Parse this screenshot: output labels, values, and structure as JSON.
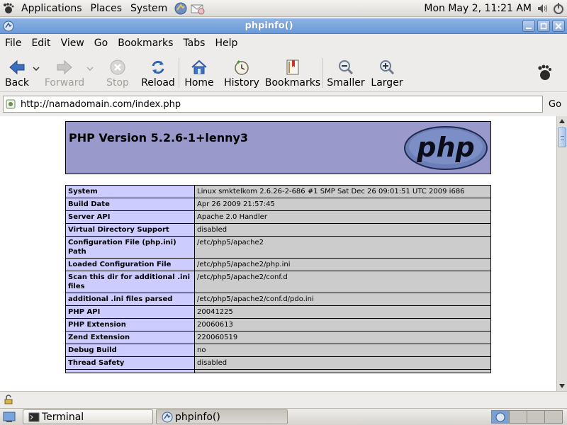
{
  "panel": {
    "menus": [
      "Applications",
      "Places",
      "System"
    ],
    "clock": "Mon May  2, 11:21 AM"
  },
  "window": {
    "title": "phpinfo()"
  },
  "menubar": [
    "File",
    "Edit",
    "View",
    "Go",
    "Bookmarks",
    "Tabs",
    "Help"
  ],
  "toolbar": {
    "back": "Back",
    "forward": "Forward",
    "stop": "Stop",
    "reload": "Reload",
    "home": "Home",
    "history": "History",
    "bookmarks": "Bookmarks",
    "smaller": "Smaller",
    "larger": "Larger"
  },
  "location": {
    "url": "http://namadomain.com/index.php",
    "go": "Go"
  },
  "page": {
    "version": "PHP Version 5.2.6-1+lenny3",
    "logo_text": "php",
    "rows": [
      {
        "key": "System",
        "value": "Linux smktelkom 2.6.26-2-686 #1 SMP Sat Dec 26 09:01:51 UTC 2009 i686"
      },
      {
        "key": "Build Date",
        "value": "Apr 26 2009 21:57:45"
      },
      {
        "key": "Server API",
        "value": "Apache 2.0 Handler"
      },
      {
        "key": "Virtual Directory Support",
        "value": "disabled"
      },
      {
        "key": "Configuration File (php.ini) Path",
        "value": "/etc/php5/apache2"
      },
      {
        "key": "Loaded Configuration File",
        "value": "/etc/php5/apache2/php.ini"
      },
      {
        "key": "Scan this dir for additional .ini files",
        "value": "/etc/php5/apache2/conf.d"
      },
      {
        "key": "additional .ini files parsed",
        "value": "/etc/php5/apache2/conf.d/pdo.ini"
      },
      {
        "key": "PHP API",
        "value": "20041225"
      },
      {
        "key": "PHP Extension",
        "value": "20060613"
      },
      {
        "key": "Zend Extension",
        "value": "220060519"
      },
      {
        "key": "Debug Build",
        "value": "no"
      },
      {
        "key": "Thread Safety",
        "value": "disabled"
      },
      {
        "key": "",
        "value": ""
      }
    ]
  },
  "taskbar": {
    "tasks": [
      "Terminal",
      "phpinfo()"
    ]
  },
  "colors": {
    "header_bg": "#9999cc",
    "key_bg": "#ccccff",
    "value_bg": "#cccccc",
    "titlebar": "#7aa4dc"
  }
}
